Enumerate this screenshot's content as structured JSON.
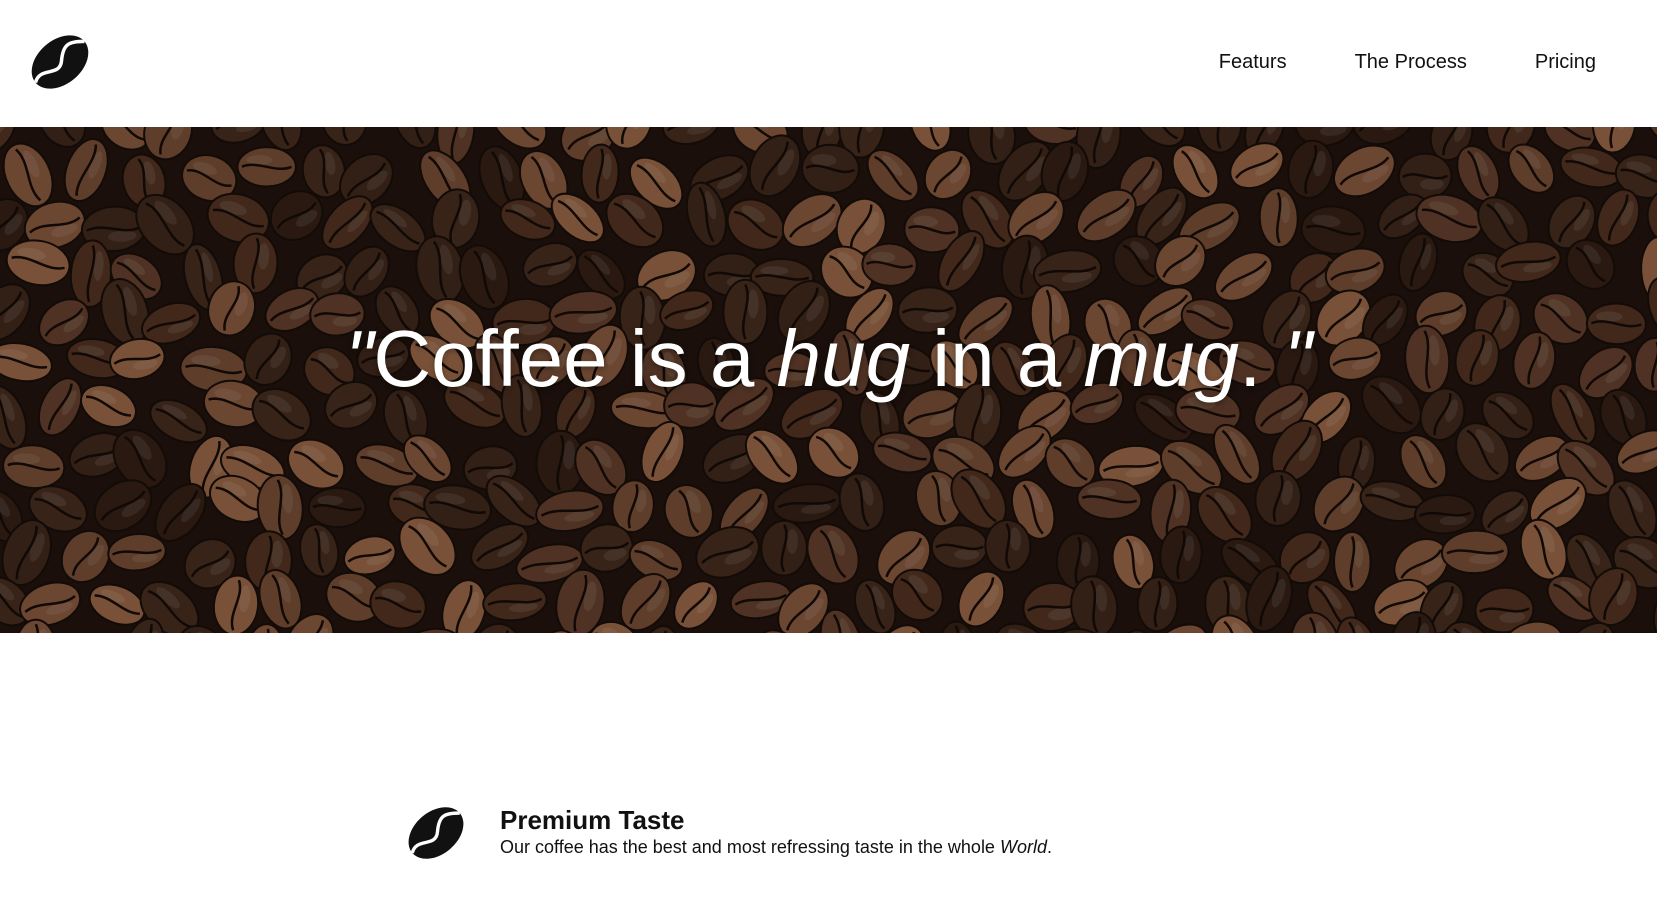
{
  "header": {
    "logo_icon": "coffee-bean-icon",
    "nav": [
      {
        "label": "Featurs"
      },
      {
        "label": "The Process"
      },
      {
        "label": "Pricing"
      }
    ]
  },
  "hero": {
    "background": "coffee-beans-photo",
    "quote": {
      "open_mark": "\"",
      "part1": "Coffee is a ",
      "emph1": "hug",
      "part2": " in a ",
      "emph2": "mug",
      "part3": ". ",
      "close_mark": "\""
    }
  },
  "features": [
    {
      "icon": "coffee-bean-icon",
      "title": "Premium Taste",
      "text_before": "Our coffee has the best and most refressing taste in the whole ",
      "text_emph": "World",
      "text_after": "."
    }
  ],
  "colors": {
    "text": "#111111",
    "hero_text": "#ffffff",
    "bean_dark": "#2b1a12",
    "bean_mid": "#5a3a28",
    "bean_light": "#8a5d40"
  }
}
